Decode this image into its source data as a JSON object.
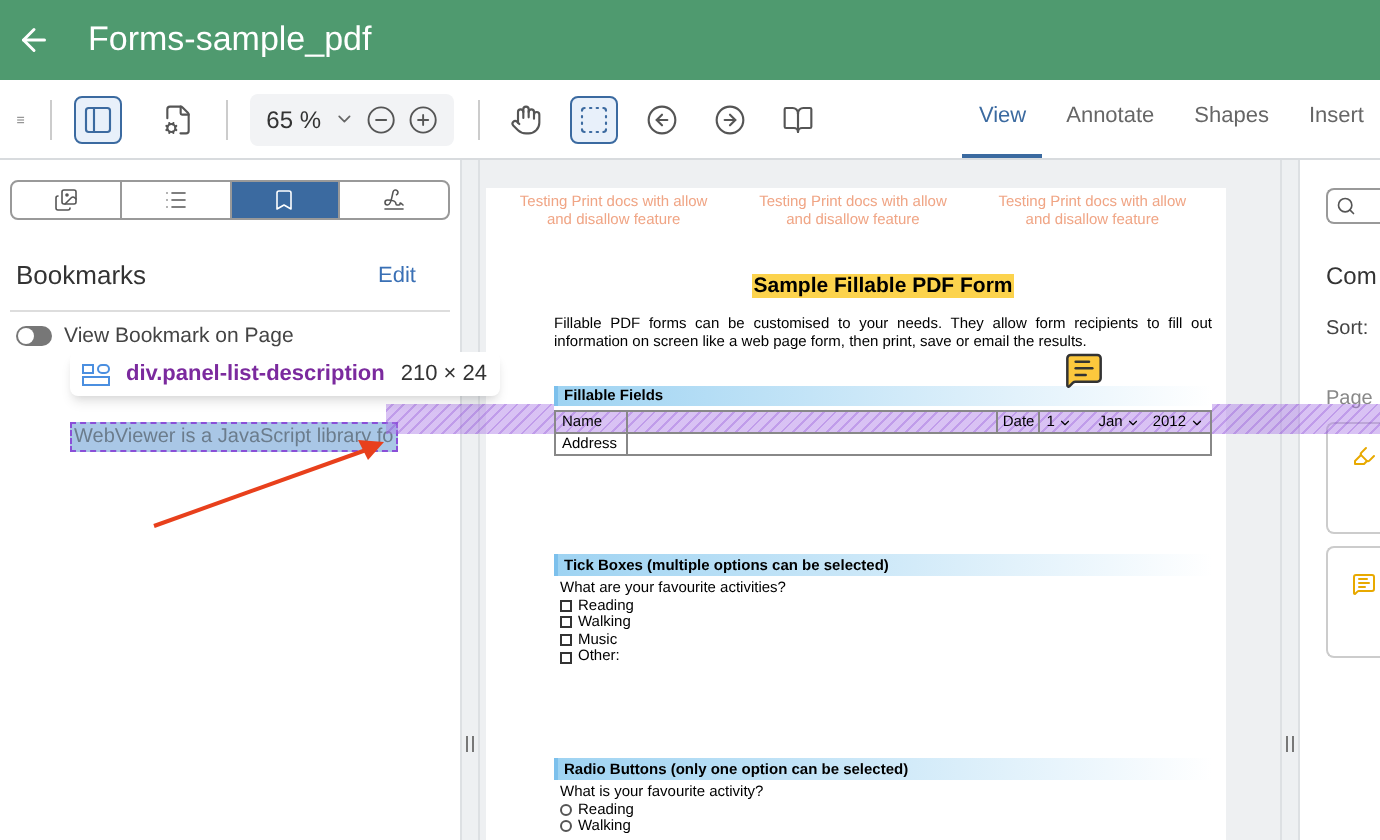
{
  "header": {
    "title": "Forms-sample_pdf"
  },
  "toolbar": {
    "tools_left": [
      {
        "kind": "panel",
        "selected": true
      },
      {
        "kind": "page-settings",
        "selected": false
      }
    ],
    "zoom": {
      "value": "65 %"
    },
    "tools_right": [
      {
        "kind": "pan",
        "selected": false
      },
      {
        "kind": "select",
        "selected": true
      },
      {
        "kind": "back",
        "selected": false
      },
      {
        "kind": "forward",
        "selected": false
      },
      {
        "kind": "book",
        "selected": false
      }
    ],
    "tabs": [
      {
        "label": "View",
        "selected": true
      },
      {
        "label": "Annotate",
        "selected": false
      },
      {
        "label": "Shapes",
        "selected": false
      },
      {
        "label": "Insert",
        "selected": false
      }
    ]
  },
  "left_panel": {
    "tabs": [
      {
        "kind": "thumbnails",
        "selected": false
      },
      {
        "kind": "outline",
        "selected": false
      },
      {
        "kind": "bookmarks",
        "selected": true
      },
      {
        "kind": "signatures",
        "selected": false
      }
    ],
    "title": "Bookmarks",
    "edit": "Edit",
    "toggle": {
      "label": "View Bookmark on Page",
      "on": false
    },
    "description": "WebViewer is a JavaScript library fo"
  },
  "inspector": {
    "selector": "div.panel-list-description",
    "size": "210 × 24"
  },
  "document": {
    "page_headers": [
      "Testing Print docs with allow and disallow feature",
      "Testing Print docs with allow and disallow feature",
      "Testing Print docs with allow and disallow feature"
    ],
    "title": "Sample Fillable PDF Form",
    "intro": "Fillable PDF forms can be customised to your needs. They allow form recipients to fill out information on screen like a web page form, then print, save or email the results.",
    "fields": {
      "heading": "Fillable Fields",
      "name_label": "Name",
      "date_label": "Date",
      "day": "1",
      "month": "Jan",
      "year": "2012",
      "address_label": "Address"
    },
    "tick_boxes": {
      "heading": "Tick Boxes (multiple options can be selected)",
      "question": "What are your favourite activities?",
      "options": [
        {
          "label": "Reading",
          "checked": false
        },
        {
          "label": "Walking",
          "checked": false
        },
        {
          "label": "Music",
          "checked": false
        },
        {
          "label": "Other:",
          "checked": false
        }
      ]
    },
    "radio_buttons": {
      "heading": "Radio Buttons (only one option can be selected)",
      "question": "What is your favourite activity?",
      "options": [
        {
          "label": "Reading",
          "selected": false
        },
        {
          "label": "Walking",
          "selected": false
        }
      ]
    }
  },
  "right_panel": {
    "title": "Com",
    "sort": "Sort:",
    "page": "Page"
  }
}
